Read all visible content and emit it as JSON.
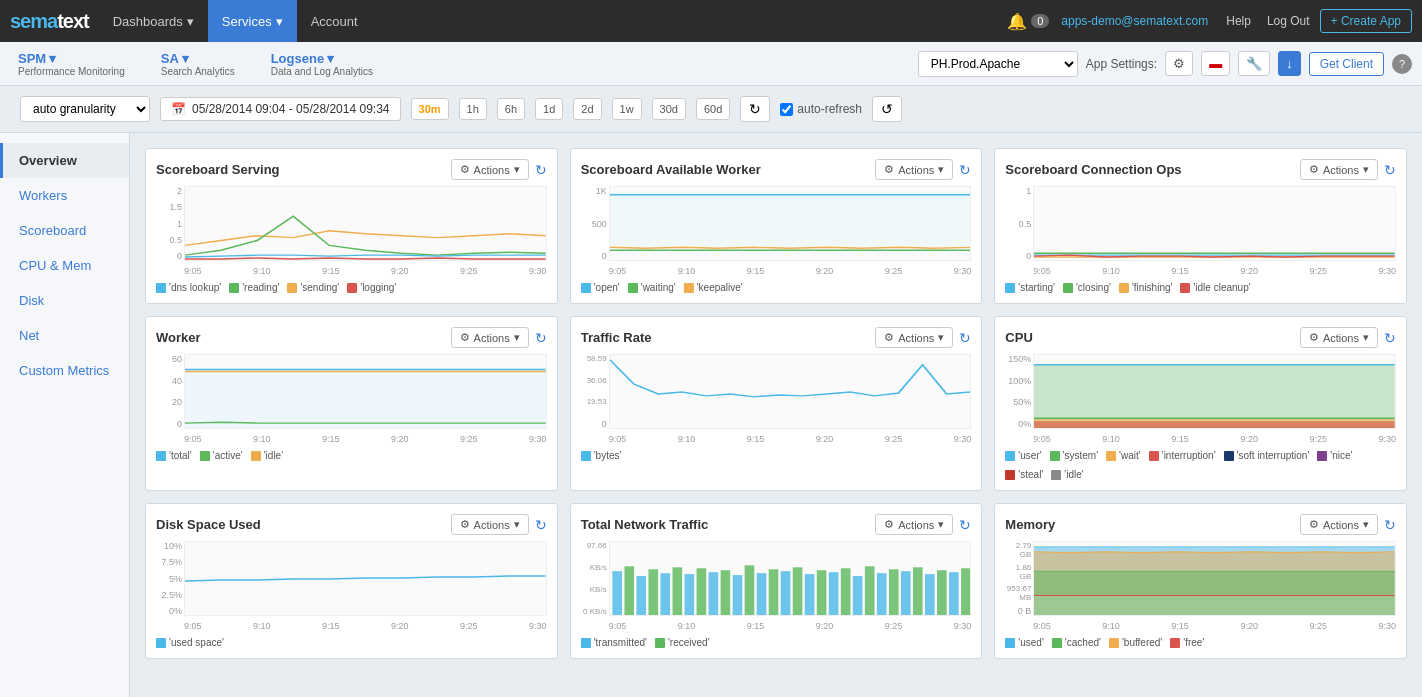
{
  "nav": {
    "logo": "sema",
    "logo_accent": "text",
    "items": [
      {
        "label": "Dashboards",
        "dropdown": true,
        "active": false
      },
      {
        "label": "Services",
        "dropdown": true,
        "active": true
      },
      {
        "label": "Account",
        "dropdown": false,
        "active": false
      }
    ],
    "bell_icon": "🔔",
    "notification_count": "0",
    "email": "apps-demo@sematext.com",
    "help": "Help",
    "logout": "Log Out",
    "create_btn": "+ Create App"
  },
  "sub_nav": {
    "items": [
      {
        "label": "SPM",
        "sublabel": "Performance Monitoring",
        "dropdown": true
      },
      {
        "label": "SA",
        "sublabel": "Search Analytics",
        "dropdown": true
      },
      {
        "label": "Logsene",
        "sublabel": "Data and Log Analytics",
        "dropdown": true
      }
    ],
    "app_selector": "PH.Prod.Apache",
    "app_settings_label": "App Settings:",
    "get_client": "Get Client",
    "help_icon": "?"
  },
  "toolbar": {
    "granularity": "auto granularity",
    "date_range": "05/28/2014 09:04 - 05/28/2014 09:34",
    "time_btns": [
      "30m",
      "1h",
      "6h",
      "1d",
      "2d",
      "1w",
      "30d",
      "60d"
    ],
    "active_time": "30m",
    "auto_refresh": "auto-refresh"
  },
  "sidebar": {
    "items": [
      {
        "label": "Overview",
        "active": true
      },
      {
        "label": "Workers",
        "active": false
      },
      {
        "label": "Scoreboard",
        "active": false
      },
      {
        "label": "CPU & Mem",
        "active": false
      },
      {
        "label": "Disk",
        "active": false
      },
      {
        "label": "Net",
        "active": false
      },
      {
        "label": "Custom Metrics",
        "active": false
      }
    ]
  },
  "charts": {
    "row1": [
      {
        "title": "Scoreboard Serving",
        "actions_label": "Actions",
        "yaxis": [
          "2",
          "1.5",
          "1",
          "0.5",
          "0"
        ],
        "xaxis": [
          "9:05",
          "9:10",
          "9:15",
          "9:20",
          "9:25",
          "9:30"
        ],
        "legend": [
          {
            "color": "#4ab8e8",
            "label": "'dns lookup'"
          },
          {
            "color": "#5cb85c",
            "label": "'reading'"
          },
          {
            "color": "#f0ad4e",
            "label": "'sending'"
          },
          {
            "color": "#d9534f",
            "label": "'logging'"
          }
        ]
      },
      {
        "title": "Scoreboard Available Worker",
        "actions_label": "Actions",
        "yaxis": [
          "1K",
          "500",
          "0"
        ],
        "xaxis": [
          "9:05",
          "9:10",
          "9:15",
          "9:20",
          "9:25",
          "9:30"
        ],
        "legend": [
          {
            "color": "#4ab8e8",
            "label": "'open'"
          },
          {
            "color": "#5cb85c",
            "label": "'waiting'"
          },
          {
            "color": "#f0ad4e",
            "label": "'keepalive'"
          }
        ]
      },
      {
        "title": "Scoreboard Connection Ops",
        "actions_label": "Actions",
        "yaxis": [
          "1",
          "0.5",
          "0"
        ],
        "xaxis": [
          "9:05",
          "9:10",
          "9:15",
          "9:20",
          "9:25",
          "9:30"
        ],
        "legend": [
          {
            "color": "#4ab8e8",
            "label": "'starting'"
          },
          {
            "color": "#5cb85c",
            "label": "'closing'"
          },
          {
            "color": "#f0ad4e",
            "label": "'finishing'"
          },
          {
            "color": "#d9534f",
            "label": "'idle cleanup'"
          }
        ]
      }
    ],
    "row2": [
      {
        "title": "Worker",
        "actions_label": "Actions",
        "yaxis": [
          "60",
          "40",
          "20",
          "0"
        ],
        "xaxis": [
          "9:05",
          "9:10",
          "9:15",
          "9:20",
          "9:25",
          "9:30"
        ],
        "legend": [
          {
            "color": "#4ab8e8",
            "label": "'total'"
          },
          {
            "color": "#5cb85c",
            "label": "'active'"
          },
          {
            "color": "#f0ad4e",
            "label": "'idle'"
          }
        ]
      },
      {
        "title": "Traffic Rate",
        "actions_label": "Actions",
        "yaxis": [
          "58.59 KB/s",
          "36.06 KB/s",
          "19.53 KB/s",
          "0 B/s"
        ],
        "xaxis": [
          "9:05",
          "9:10",
          "9:15",
          "9:20",
          "9:25",
          "9:30"
        ],
        "legend": [
          {
            "color": "#4ab8e8",
            "label": "'bytes'"
          }
        ]
      },
      {
        "title": "CPU",
        "actions_label": "Actions",
        "yaxis": [
          "150%",
          "100%",
          "50%",
          "0%"
        ],
        "xaxis": [
          "9:05",
          "9:10",
          "9:15",
          "9:20",
          "9:25",
          "9:30"
        ],
        "legend": [
          {
            "color": "#4ab8e8",
            "label": "'user'"
          },
          {
            "color": "#5cb85c",
            "label": "'system'"
          },
          {
            "color": "#f0ad4e",
            "label": "'wait'"
          },
          {
            "color": "#d9534f",
            "label": "'interruption'"
          },
          {
            "color": "#1a3a6b",
            "label": "'soft interruption'"
          },
          {
            "color": "#7b3f8c",
            "label": "'nice'"
          },
          {
            "color": "#c0392b",
            "label": "'steal'"
          },
          {
            "color": "#8a8a8a",
            "label": "'idle'"
          }
        ]
      }
    ],
    "row3": [
      {
        "title": "Disk Space Used",
        "actions_label": "Actions",
        "yaxis": [
          "10%",
          "7.5%",
          "5%",
          "2.5%",
          "0%"
        ],
        "xaxis": [
          "9:05",
          "9:10",
          "9:15",
          "9:20",
          "9:25",
          "9:30"
        ],
        "legend": [
          {
            "color": "#4ab8e8",
            "label": "'used space'"
          }
        ]
      },
      {
        "title": "Total Network Traffic",
        "actions_label": "Actions",
        "yaxis": [
          "97.66 KB/s",
          "KB/s",
          "KB/s",
          "KB/s",
          "0 KB/s"
        ],
        "xaxis": [
          "9:05",
          "9:10",
          "9:15",
          "9:20",
          "9:25",
          "9:30"
        ],
        "legend": [
          {
            "color": "#4ab8e8",
            "label": "'transmitted'"
          },
          {
            "color": "#5cb85c",
            "label": "'received'"
          }
        ]
      },
      {
        "title": "Memory",
        "actions_label": "Actions",
        "yaxis": [
          "2.79 GB",
          "1.86 GB",
          "953.67 MB",
          "0 B"
        ],
        "xaxis": [
          "9:05",
          "9:10",
          "9:15",
          "9:20",
          "9:25",
          "9:30"
        ],
        "legend": [
          {
            "color": "#4ab8e8",
            "label": "'used'"
          },
          {
            "color": "#5cb85c",
            "label": "'cached'"
          },
          {
            "color": "#f0ad4e",
            "label": "'buffered'"
          },
          {
            "color": "#d9534f",
            "label": "'free'"
          }
        ]
      }
    ]
  }
}
